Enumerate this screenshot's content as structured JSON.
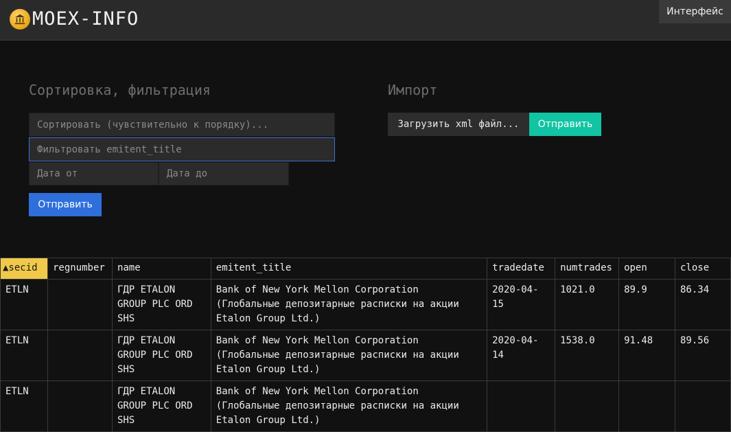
{
  "header": {
    "brand": "MOEX-INFO",
    "logo_icon": "bank-icon",
    "interface_label": "Интерфейс"
  },
  "sort_filter": {
    "title": "Сортировка, фильтрация",
    "sort_placeholder": "Сортировать (чувствительно к порядку)...",
    "filter_placeholder": "Фильтровать emitent_title",
    "date_from_placeholder": "Дата от",
    "date_to_placeholder": "Дата до",
    "submit_label": "Отправить"
  },
  "import": {
    "title": "Импорт",
    "upload_label": "Загрузить xml файл...",
    "submit_label": "Отправить"
  },
  "table": {
    "columns": [
      "▲secid",
      "regnumber",
      "name",
      "emitent_title",
      "tradedate",
      "numtrades",
      "open",
      "close"
    ],
    "rows": [
      {
        "secid": "ETLN",
        "regnumber": "",
        "name": "ГДР ETALON GROUP PLC ORD SHS",
        "emitent_title": "Bank of New York Mellon Corporation (Глобальные депозитарные расписки на акции Etalon Group Ltd.)",
        "tradedate": "2020-04-15",
        "numtrades": "1021.0",
        "open": "89.9",
        "close": "86.34"
      },
      {
        "secid": "ETLN",
        "regnumber": "",
        "name": "ГДР ETALON GROUP PLC ORD SHS",
        "emitent_title": "Bank of New York Mellon Corporation (Глобальные депозитарные расписки на акции Etalon Group Ltd.)",
        "tradedate": "2020-04-14",
        "numtrades": "1538.0",
        "open": "91.48",
        "close": "89.56"
      },
      {
        "secid": "ETLN",
        "regnumber": "",
        "name": "ГДР ETALON GROUP PLC ORD SHS",
        "emitent_title": "Bank of New York Mellon Corporation (Глобальные депозитарные расписки на акции Etalon Group Ltd.)",
        "tradedate": "",
        "numtrades": "",
        "open": "",
        "close": ""
      }
    ]
  },
  "colors": {
    "accent_blue": "#2f6fdc",
    "accent_teal": "#11c4a3",
    "sort_highlight": "#f0c94a"
  }
}
